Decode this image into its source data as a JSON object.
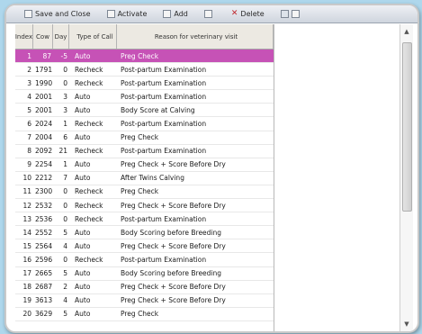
{
  "toolbar": {
    "save_close_label": "Save and Close",
    "activate_label": "Activate",
    "add_label": "Add",
    "delete_label": "Delete"
  },
  "grid": {
    "columns": {
      "index": "Index",
      "cow": "Cow",
      "day": "Day",
      "type": "Type of Call",
      "reason": "Reason for veterinary visit"
    },
    "rows": [
      {
        "index": "1",
        "cow": "87",
        "day": "-5",
        "type": "Auto",
        "reason": "Preg Check",
        "selected": true
      },
      {
        "index": "2",
        "cow": "1791",
        "day": "0",
        "type": "Recheck",
        "reason": "Post-partum Examination"
      },
      {
        "index": "3",
        "cow": "1990",
        "day": "0",
        "type": "Recheck",
        "reason": "Post-partum Examination"
      },
      {
        "index": "4",
        "cow": "2001",
        "day": "3",
        "type": "Auto",
        "reason": "Post-partum Examination"
      },
      {
        "index": "5",
        "cow": "2001",
        "day": "3",
        "type": "Auto",
        "reason": "Body Score at Calving"
      },
      {
        "index": "6",
        "cow": "2024",
        "day": "1",
        "type": "Recheck",
        "reason": "Post-partum Examination"
      },
      {
        "index": "7",
        "cow": "2004",
        "day": "6",
        "type": "Auto",
        "reason": "Preg Check"
      },
      {
        "index": "8",
        "cow": "2092",
        "day": "21",
        "type": "Recheck",
        "reason": "Post-partum Examination"
      },
      {
        "index": "9",
        "cow": "2254",
        "day": "1",
        "type": "Auto",
        "reason": "Preg Check + Score Before Dry"
      },
      {
        "index": "10",
        "cow": "2212",
        "day": "7",
        "type": "Auto",
        "reason": "After Twins Calving"
      },
      {
        "index": "11",
        "cow": "2300",
        "day": "0",
        "type": "Recheck",
        "reason": "Preg Check"
      },
      {
        "index": "12",
        "cow": "2532",
        "day": "0",
        "type": "Recheck",
        "reason": "Preg Check + Score Before Dry"
      },
      {
        "index": "13",
        "cow": "2536",
        "day": "0",
        "type": "Recheck",
        "reason": "Post-partum Examination"
      },
      {
        "index": "14",
        "cow": "2552",
        "day": "5",
        "type": "Auto",
        "reason": "Body Scoring before Breeding"
      },
      {
        "index": "15",
        "cow": "2564",
        "day": "4",
        "type": "Auto",
        "reason": "Preg Check + Score Before Dry"
      },
      {
        "index": "16",
        "cow": "2596",
        "day": "0",
        "type": "Recheck",
        "reason": "Post-partum Examination"
      },
      {
        "index": "17",
        "cow": "2665",
        "day": "5",
        "type": "Auto",
        "reason": "Body Scoring before Breeding"
      },
      {
        "index": "18",
        "cow": "2687",
        "day": "2",
        "type": "Auto",
        "reason": "Preg Check + Score Before Dry"
      },
      {
        "index": "19",
        "cow": "3613",
        "day": "4",
        "type": "Auto",
        "reason": "Preg Check + Score Before Dry"
      },
      {
        "index": "20",
        "cow": "3629",
        "day": "5",
        "type": "Auto",
        "reason": "Preg Check"
      }
    ]
  },
  "colors": {
    "selected_row": "#c652b6",
    "page_background": "#aed7ec"
  }
}
